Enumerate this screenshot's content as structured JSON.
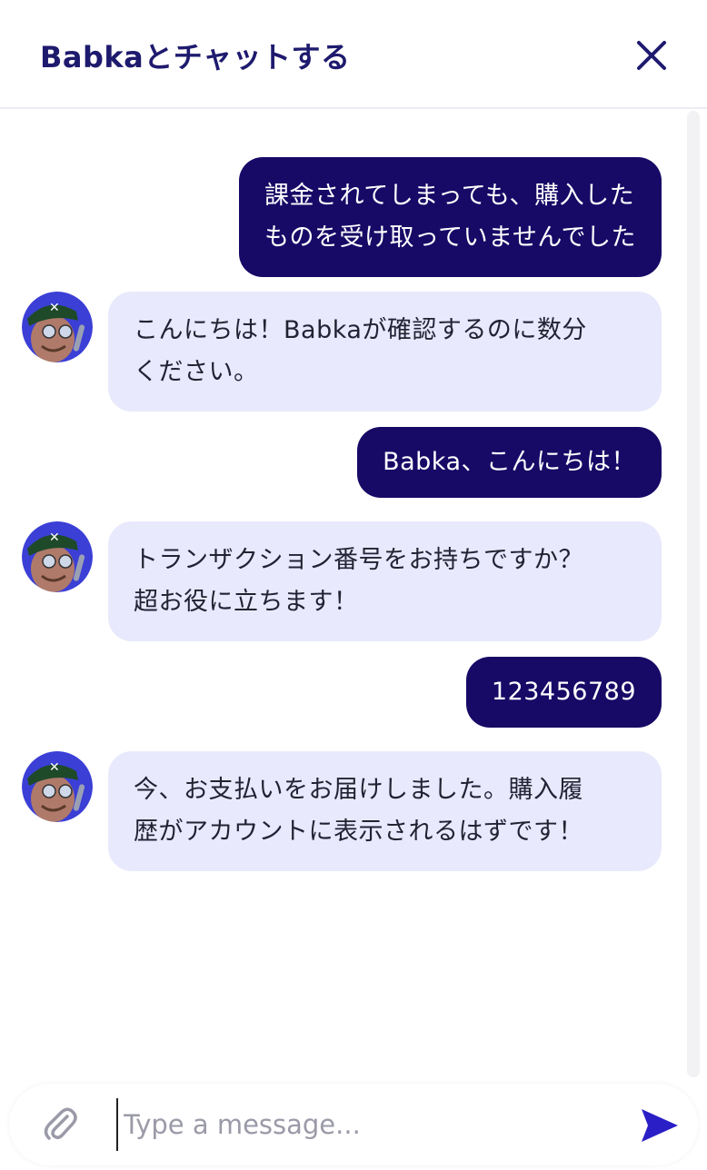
{
  "header": {
    "title": "Babkaとチャットする",
    "close_icon": "close-icon"
  },
  "messages": [
    {
      "role": "user",
      "text": "課金されてしまっても、購入した\nものを受け取っていませんでした"
    },
    {
      "role": "bot",
      "text": "こんにちは！Babkaが確認するのに数分\nください。"
    },
    {
      "role": "user",
      "text": "Babka、こんにちは！"
    },
    {
      "role": "bot",
      "text": "トランザクション番号をお持ちですか？\n超お役に立ちます！"
    },
    {
      "role": "user",
      "text": "123456789"
    },
    {
      "role": "bot",
      "text": "今、お支払いをお届けしました。購入履\n歴がアカウントに表示されるはずです！"
    }
  ],
  "composer": {
    "placeholder": "Type a message...",
    "attach_icon": "paperclip-icon",
    "send_icon": "send-icon"
  },
  "colors": {
    "user_bubble": "#170966",
    "bot_bubble": "#e8e9fc",
    "title": "#1e1a6e",
    "send": "#2a1fc7"
  }
}
